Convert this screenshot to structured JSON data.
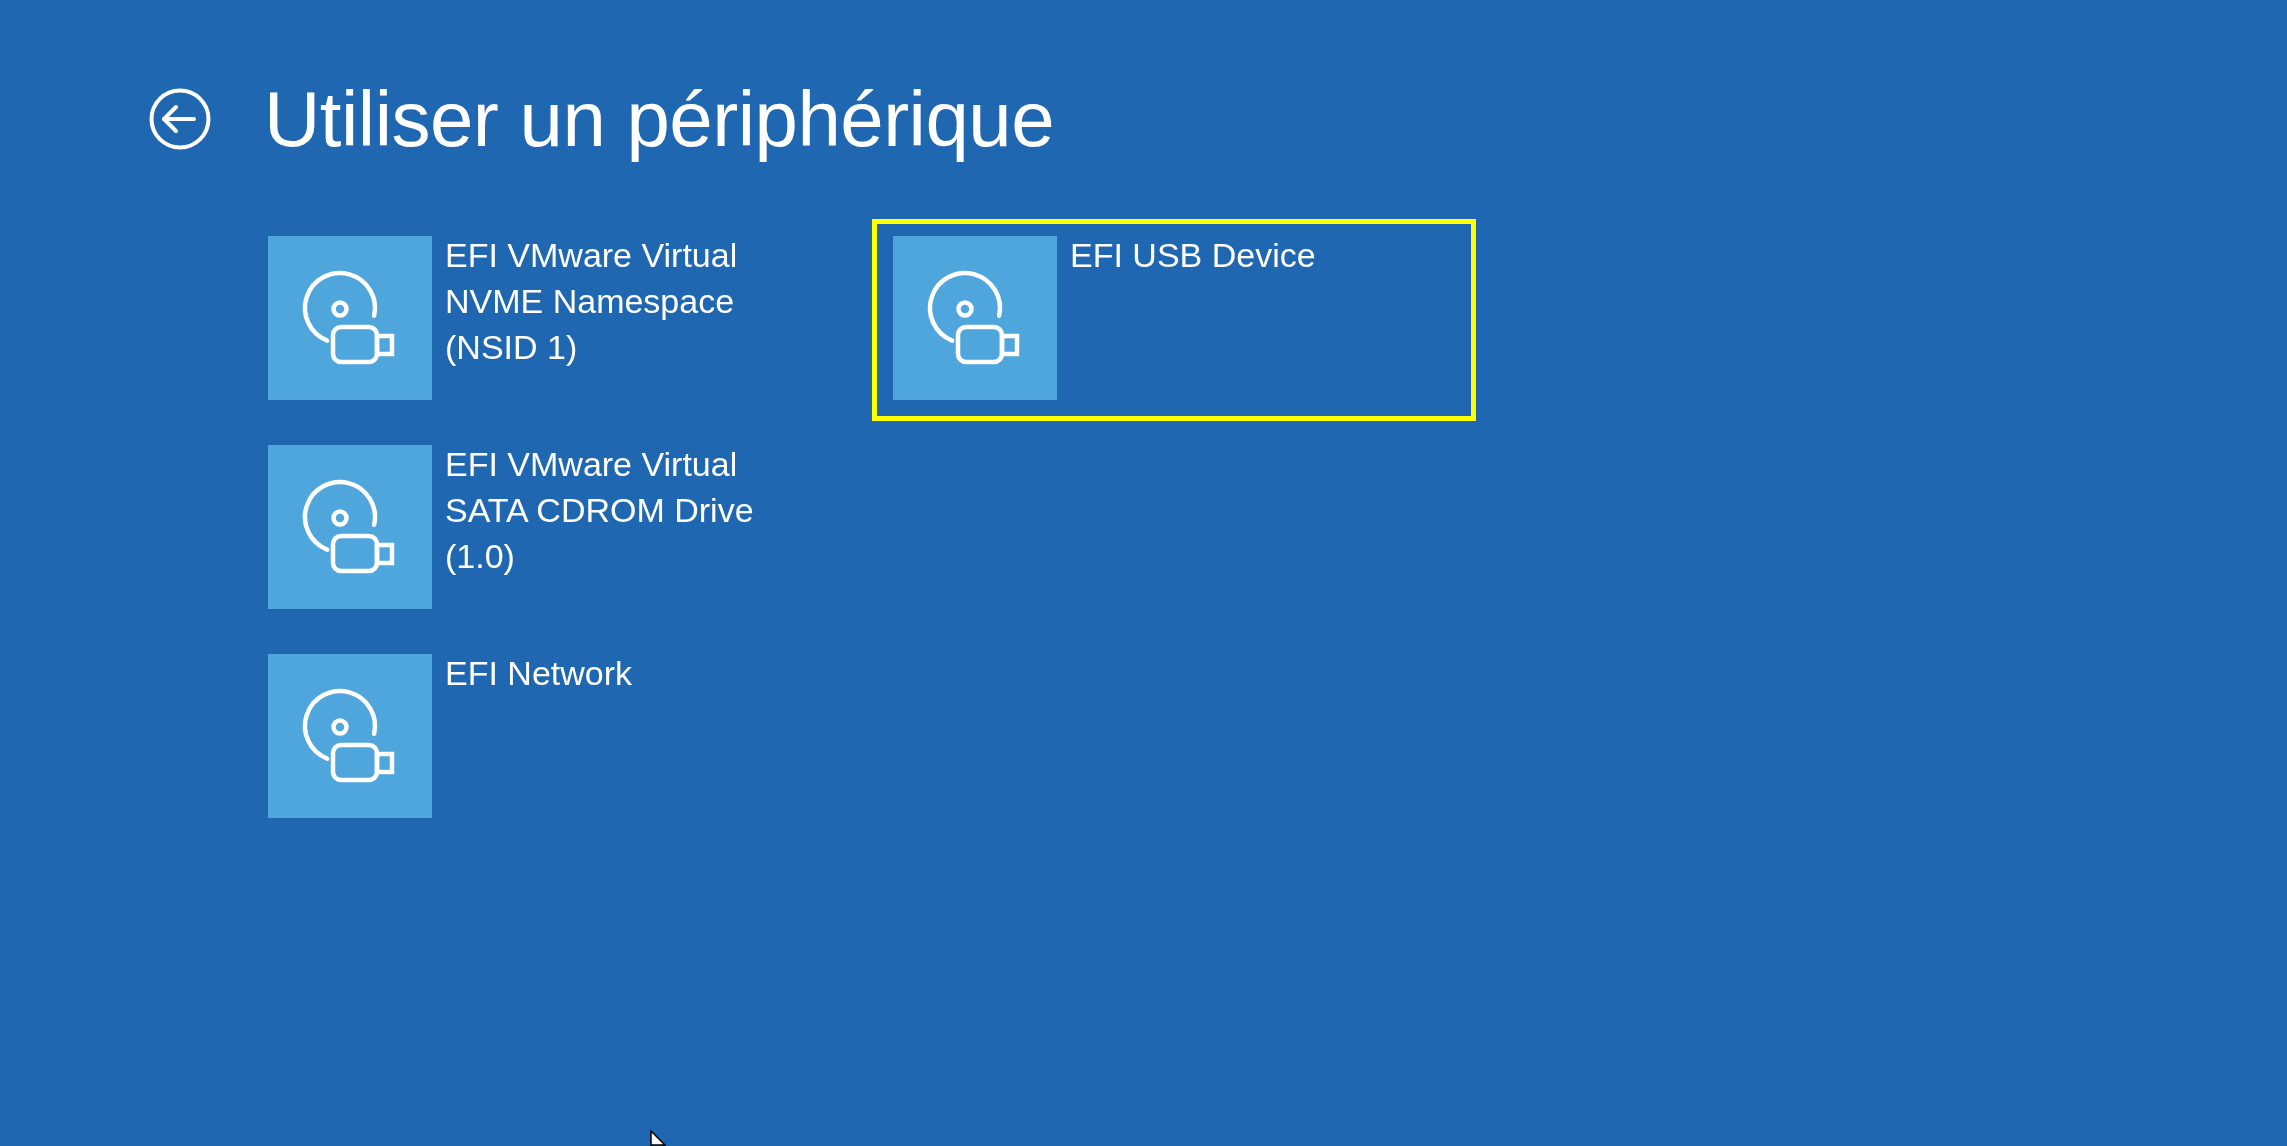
{
  "page": {
    "title": "Utiliser un périphérique"
  },
  "devices": [
    {
      "name": "EFI VMware Virtual NVME Namespace (NSID 1)",
      "selected": false
    },
    {
      "name": "EFI VMware Virtual SATA CDROM Drive (1.0)",
      "selected": false
    },
    {
      "name": "EFI Network",
      "selected": false
    },
    {
      "name": "EFI USB Device",
      "selected": true
    }
  ]
}
